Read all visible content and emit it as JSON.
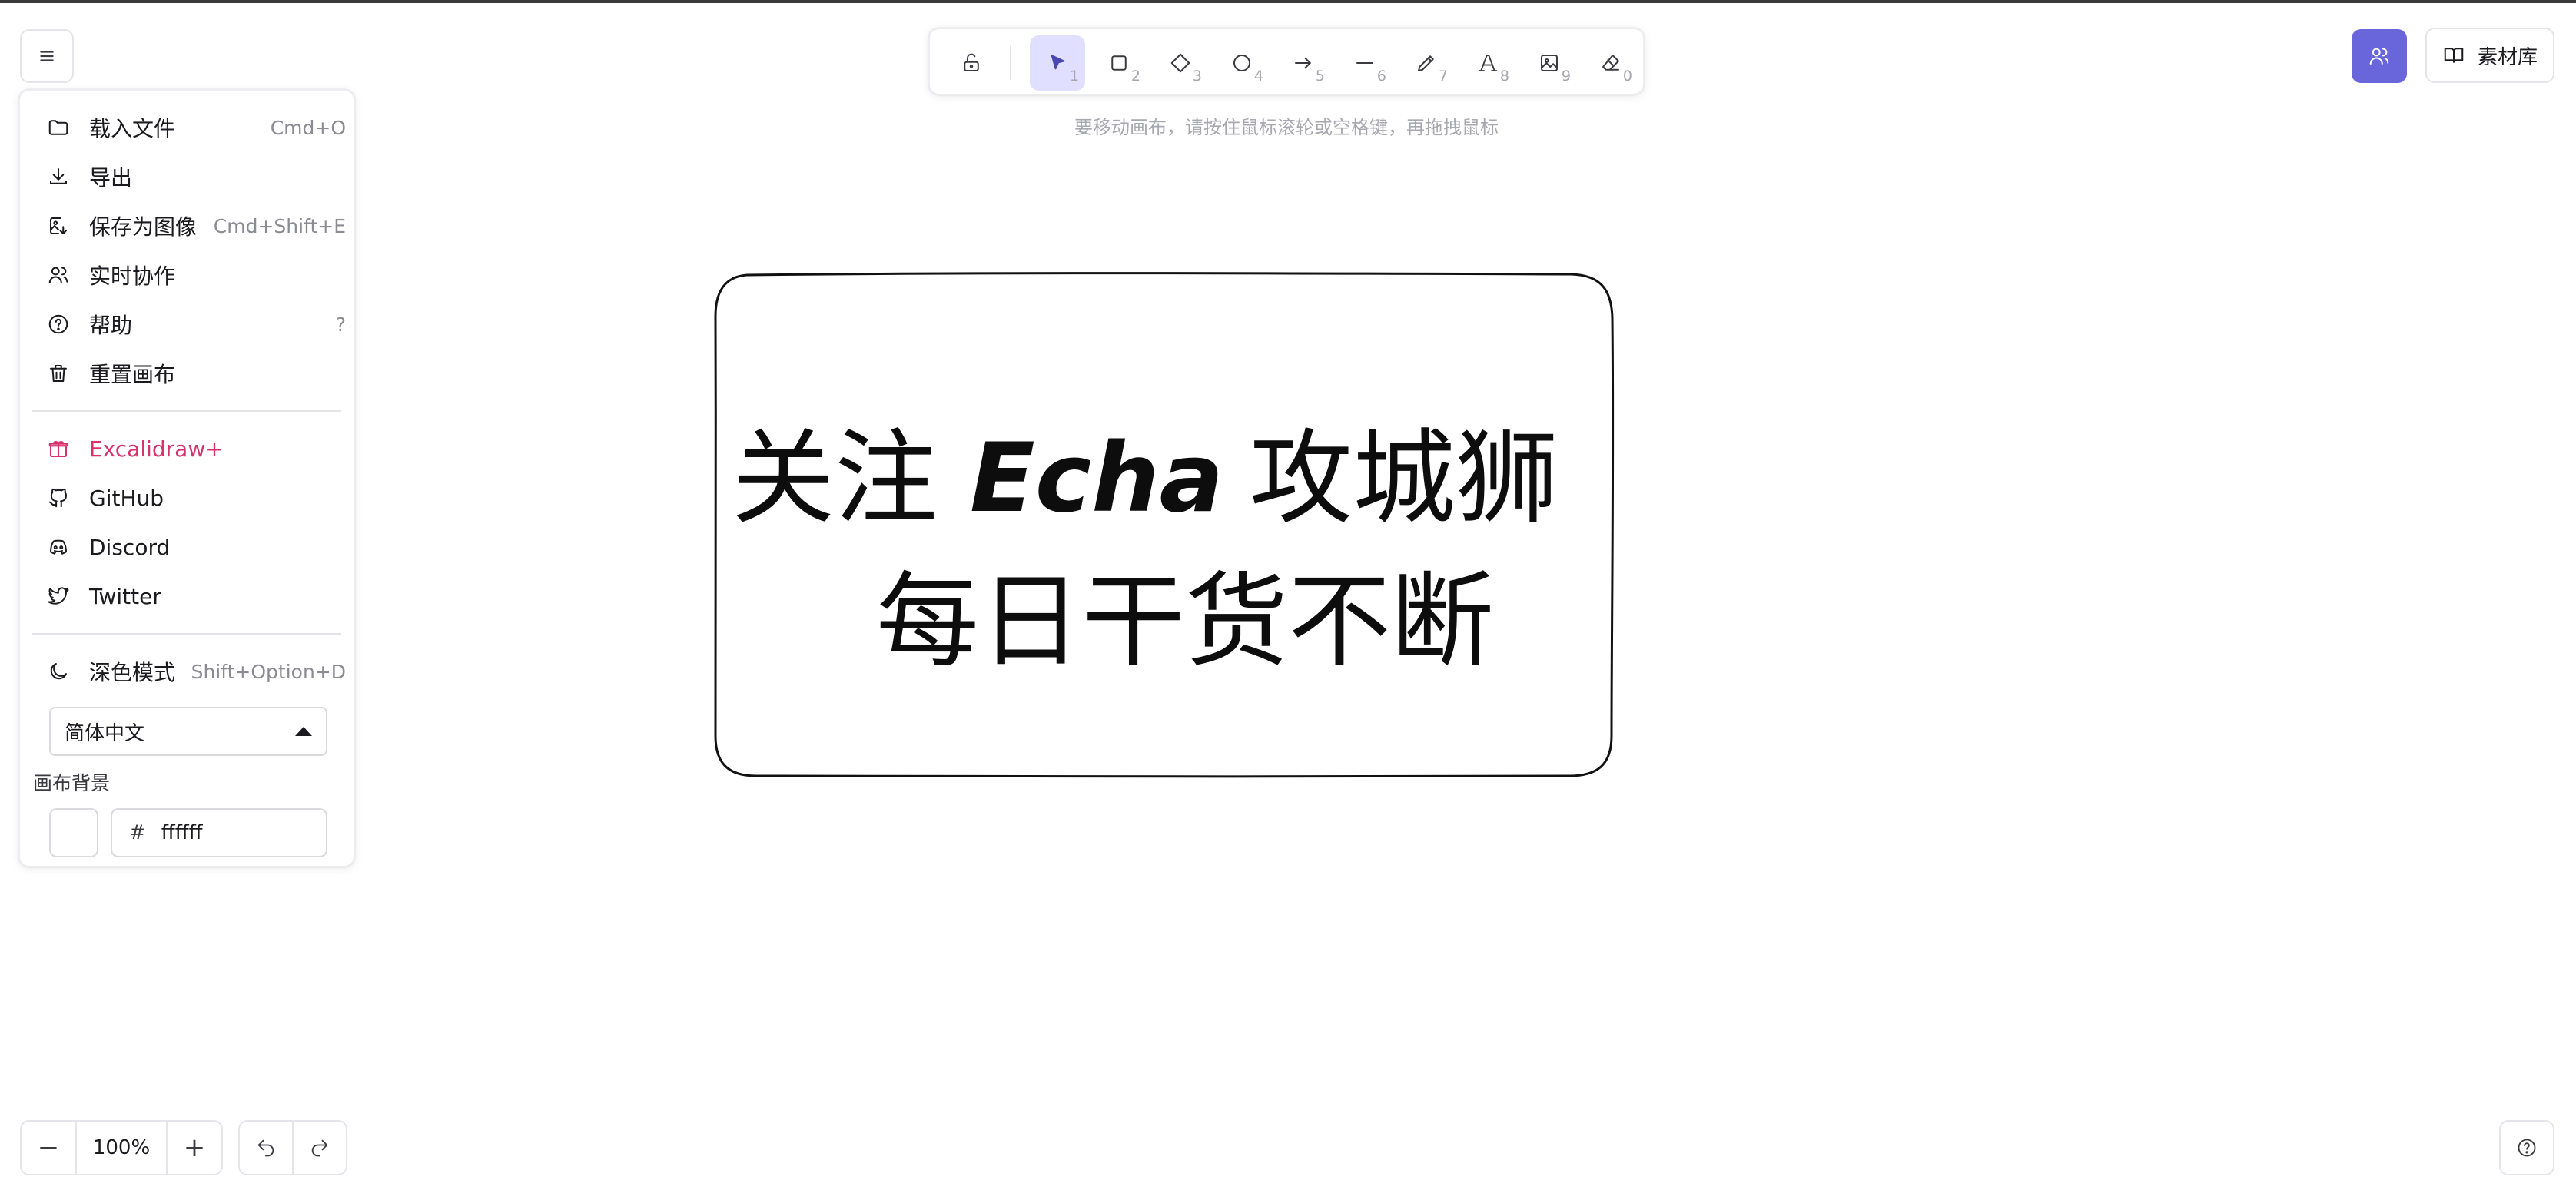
{
  "menu": {
    "items": [
      {
        "label": "载入文件",
        "shortcut": "Cmd+O",
        "icon": "folder-icon"
      },
      {
        "label": "导出",
        "shortcut": "",
        "icon": "download-icon"
      },
      {
        "label": "保存为图像",
        "shortcut": "Cmd+Shift+E",
        "icon": "image-export-icon"
      },
      {
        "label": "实时协作",
        "shortcut": "",
        "icon": "users-icon"
      },
      {
        "label": "帮助",
        "shortcut": "?",
        "icon": "help-circle-icon"
      },
      {
        "label": "重置画布",
        "shortcut": "",
        "icon": "trash-icon"
      }
    ],
    "links": [
      {
        "label": "Excalidraw+",
        "icon": "gift-icon"
      },
      {
        "label": "GitHub",
        "icon": "github-icon"
      },
      {
        "label": "Discord",
        "icon": "discord-icon"
      },
      {
        "label": "Twitter",
        "icon": "twitter-icon"
      }
    ],
    "dark_mode": {
      "label": "深色模式",
      "shortcut": "Shift+Option+D",
      "icon": "moon-icon"
    },
    "language": "简体中文",
    "canvas_bg_label": "画布背景",
    "canvas_bg_hash": "#",
    "canvas_bg_value": "ffffff",
    "canvas_bg_color": "#ffffff"
  },
  "toolbar": {
    "tools": [
      {
        "name": "selection",
        "key": "1",
        "icon": "pointer-icon",
        "active": true
      },
      {
        "name": "rectangle",
        "key": "2",
        "icon": "square-icon"
      },
      {
        "name": "diamond",
        "key": "3",
        "icon": "diamond-icon"
      },
      {
        "name": "ellipse",
        "key": "4",
        "icon": "circle-icon"
      },
      {
        "name": "arrow",
        "key": "5",
        "icon": "arrow-right-icon"
      },
      {
        "name": "line",
        "key": "6",
        "icon": "line-icon"
      },
      {
        "name": "draw",
        "key": "7",
        "icon": "pencil-icon"
      },
      {
        "name": "text",
        "key": "8",
        "icon": "text-icon"
      },
      {
        "name": "image",
        "key": "9",
        "icon": "image-icon"
      },
      {
        "name": "eraser",
        "key": "0",
        "icon": "eraser-icon"
      }
    ],
    "lock_icon": "lock-open-icon",
    "hint": "要移动画布，请按住鼠标滚轮或空格键，再拖拽鼠标"
  },
  "header": {
    "library_label": "素材库",
    "collab_icon": "users-icon",
    "accent": "#6965db"
  },
  "canvas": {
    "line1_a": "关注",
    "line1_b": "Echa",
    "line1_c": "攻城狮",
    "line2": "每日干货不断"
  },
  "footer": {
    "zoom": "100%",
    "zoom_out": "−",
    "zoom_in": "+"
  }
}
